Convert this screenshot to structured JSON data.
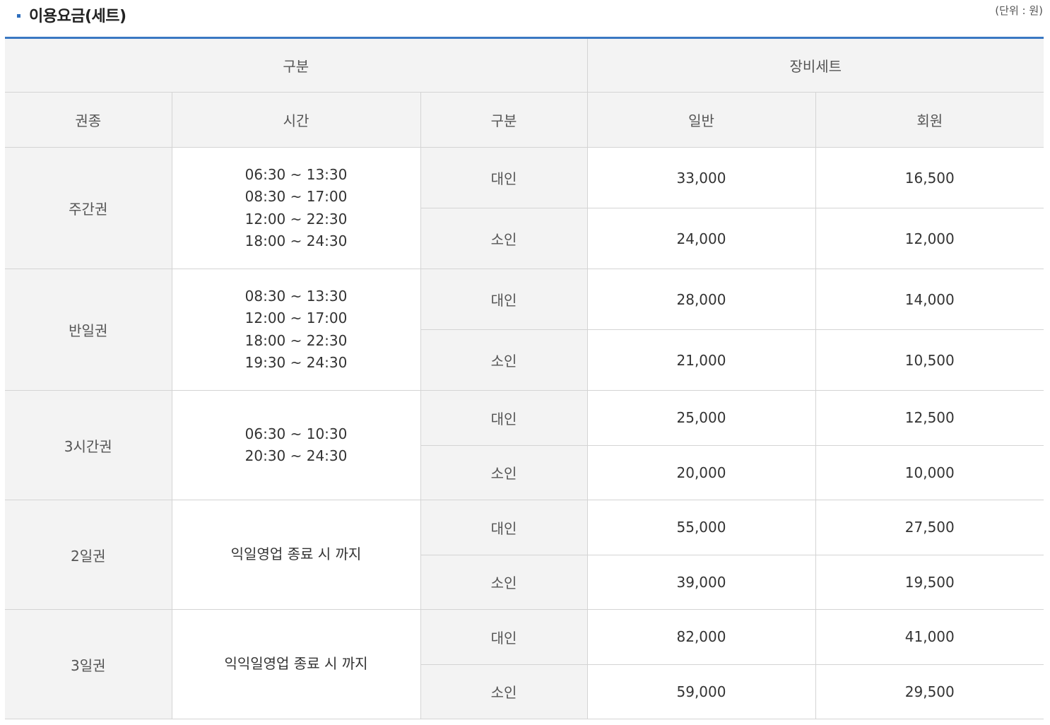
{
  "title": "이용요금(세트)",
  "unit_note": "(단위 : 원)",
  "colors": {
    "accent": "#3a78c2",
    "header_bg": "#f3f3f3",
    "border": "#d4d4d4"
  },
  "header": {
    "group_label": "구분",
    "equipment_label": "장비세트",
    "ticket_type": "권종",
    "time": "시간",
    "category": "구분",
    "general": "일반",
    "member": "회원"
  },
  "rows": [
    {
      "ticket": "주간권",
      "times": [
        "06:30 ~ 13:30",
        "08:30 ~ 17:00",
        "12:00 ~ 22:30",
        "18:00 ~ 24:30"
      ],
      "adult": {
        "label": "대인",
        "general": "33,000",
        "member": "16,500"
      },
      "child": {
        "label": "소인",
        "general": "24,000",
        "member": "12,000"
      }
    },
    {
      "ticket": "반일권",
      "times": [
        "08:30 ~ 13:30",
        "12:00 ~ 17:00",
        "18:00 ~ 22:30",
        "19:30 ~ 24:30"
      ],
      "adult": {
        "label": "대인",
        "general": "28,000",
        "member": "14,000"
      },
      "child": {
        "label": "소인",
        "general": "21,000",
        "member": "10,500"
      }
    },
    {
      "ticket": "3시간권",
      "times": [
        "06:30 ~ 10:30",
        "20:30 ~ 24:30"
      ],
      "adult": {
        "label": "대인",
        "general": "25,000",
        "member": "12,500"
      },
      "child": {
        "label": "소인",
        "general": "20,000",
        "member": "10,000"
      }
    },
    {
      "ticket": "2일권",
      "times": [
        "익일영업 종료 시 까지"
      ],
      "adult": {
        "label": "대인",
        "general": "55,000",
        "member": "27,500"
      },
      "child": {
        "label": "소인",
        "general": "39,000",
        "member": "19,500"
      }
    },
    {
      "ticket": "3일권",
      "times": [
        "익익일영업 종료 시 까지"
      ],
      "adult": {
        "label": "대인",
        "general": "82,000",
        "member": "41,000"
      },
      "child": {
        "label": "소인",
        "general": "59,000",
        "member": "29,500"
      }
    }
  ]
}
